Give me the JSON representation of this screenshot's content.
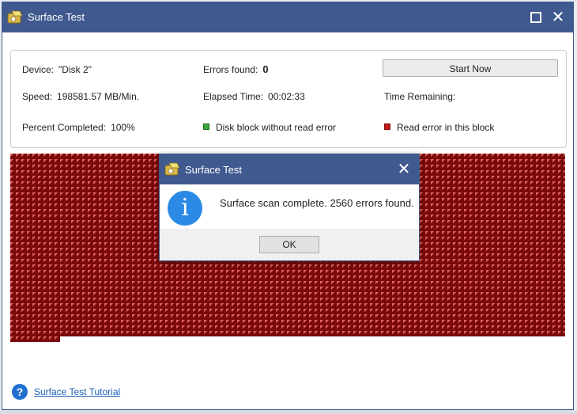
{
  "window": {
    "title": "Surface Test",
    "close_glyph": "✕"
  },
  "info": {
    "device_label": "Device:",
    "device_value": "\"Disk 2\"",
    "errors_label": "Errors found:",
    "errors_value": "0",
    "start_button": "Start Now",
    "speed_label": "Speed:",
    "speed_value": "198581.57 MB/Min.",
    "elapsed_label": "Elapsed Time:",
    "elapsed_value": "00:02:33",
    "remaining_label": "Time Remaining:",
    "percent_label": "Percent Completed:",
    "percent_value": "100%",
    "legend_ok": "Disk block without read error",
    "legend_err": "Read error in this block"
  },
  "colors": {
    "titlebar": "#40598f",
    "ok_block": "#3aa83a",
    "error_block": "#c41a1a",
    "info_blue": "#2a8ae6"
  },
  "dialog": {
    "title": "Surface Test",
    "message": "Surface scan complete. 2560 errors found.",
    "ok_button": "OK",
    "icon_glyph": "i"
  },
  "footer": {
    "help_glyph": "?",
    "tutorial_link": "Surface Test Tutorial"
  }
}
